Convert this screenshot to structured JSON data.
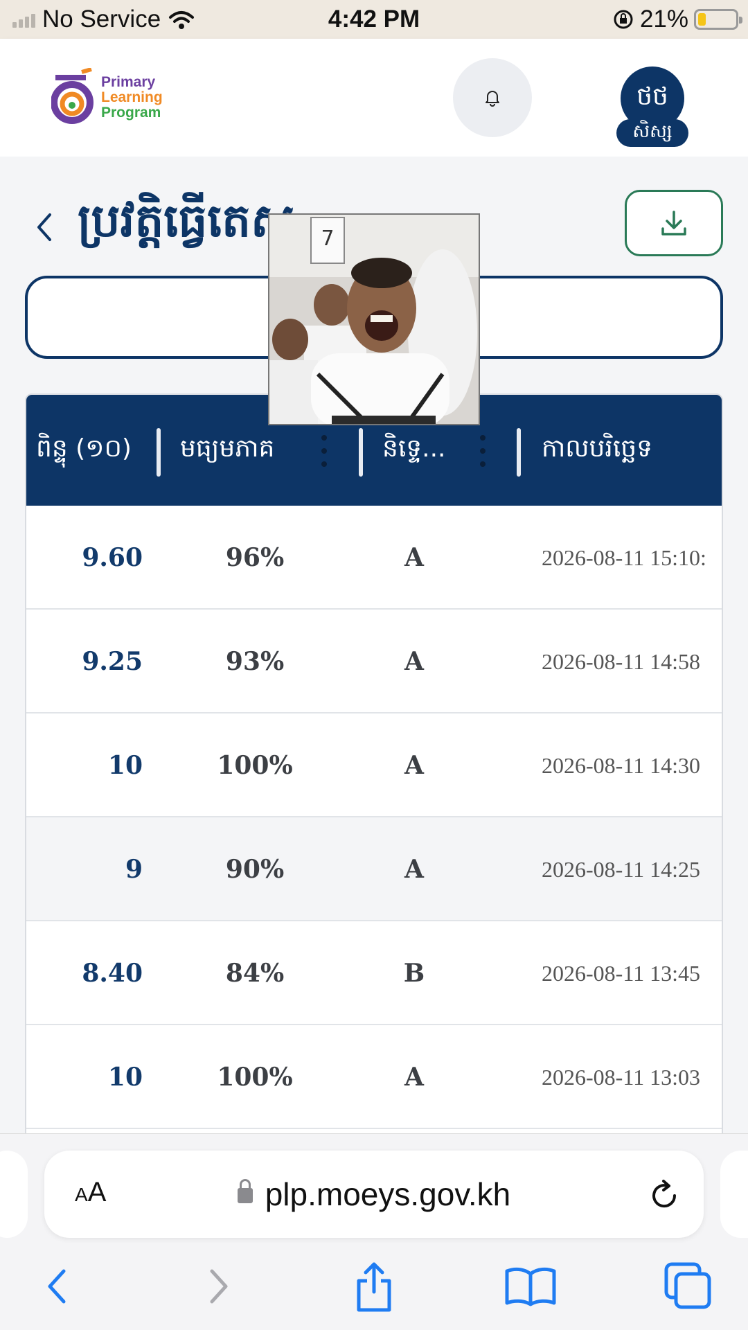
{
  "status_bar": {
    "carrier": "No Service",
    "time": "4:42 PM",
    "battery_percent": "21%",
    "battery_level": 0.21
  },
  "header": {
    "logo": {
      "line1": "Primary",
      "line2": "Learning",
      "line3": "Program",
      "icon": "plp-logo"
    },
    "bell_icon": "bell-icon",
    "avatar_initials": "ថថ",
    "role": "សិស្ស"
  },
  "page": {
    "title": "ប្រវត្តិធ្វើតេស្ត",
    "back_icon": "chevron-left-icon",
    "download_icon": "download-icon",
    "search": {
      "value": "",
      "placeholder": ""
    }
  },
  "table": {
    "columns": [
      "ពិន្ទុ (១០)",
      "មធ្យមភាគ",
      "និទ្ទេ...",
      "កាលបរិច្ឆេទ"
    ],
    "rows": [
      {
        "score": "9.60",
        "percent": "96%",
        "grade": "A",
        "date": "2026-08-11 15:10:"
      },
      {
        "score": "9.25",
        "percent": "93%",
        "grade": "A",
        "date": "2026-08-11 14:58"
      },
      {
        "score": "10",
        "percent": "100%",
        "grade": "A",
        "date": "2026-08-11 14:30"
      },
      {
        "score": "9",
        "percent": "90%",
        "grade": "A",
        "date": "2026-08-11 14:25"
      },
      {
        "score": "8.40",
        "percent": "84%",
        "grade": "B",
        "date": "2026-08-11 13:45"
      },
      {
        "score": "10",
        "percent": "100%",
        "grade": "A",
        "date": "2026-08-11 13:03"
      }
    ]
  },
  "browser": {
    "text_size_label_small": "A",
    "text_size_label_large": "A",
    "url": "plp.moeys.gov.kh",
    "icons": [
      "lock-icon",
      "reload-icon",
      "back-arrow-icon",
      "forward-arrow-icon",
      "share-icon",
      "bookmarks-icon",
      "tabs-icon"
    ]
  },
  "colors": {
    "brand_navy": "#0d3566",
    "download_green": "#2a7a57",
    "ios_blue": "#1f7cf2"
  }
}
